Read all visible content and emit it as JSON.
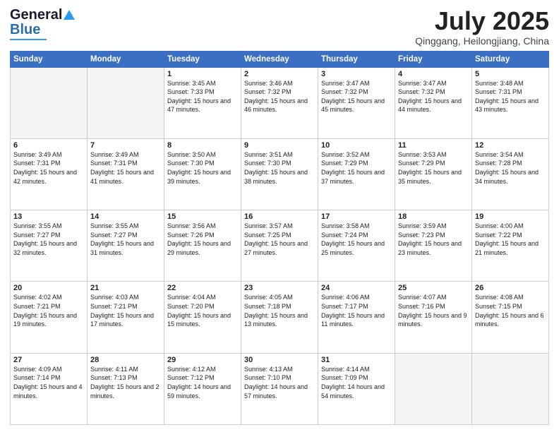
{
  "logo": {
    "line1": "General",
    "line2": "Blue"
  },
  "title": "July 2025",
  "location": "Qinggang, Heilongjiang, China",
  "weekdays": [
    "Sunday",
    "Monday",
    "Tuesday",
    "Wednesday",
    "Thursday",
    "Friday",
    "Saturday"
  ],
  "weeks": [
    [
      {
        "day": "",
        "info": ""
      },
      {
        "day": "",
        "info": ""
      },
      {
        "day": "1",
        "info": "Sunrise: 3:45 AM\nSunset: 7:33 PM\nDaylight: 15 hours\nand 47 minutes."
      },
      {
        "day": "2",
        "info": "Sunrise: 3:46 AM\nSunset: 7:32 PM\nDaylight: 15 hours\nand 46 minutes."
      },
      {
        "day": "3",
        "info": "Sunrise: 3:47 AM\nSunset: 7:32 PM\nDaylight: 15 hours\nand 45 minutes."
      },
      {
        "day": "4",
        "info": "Sunrise: 3:47 AM\nSunset: 7:32 PM\nDaylight: 15 hours\nand 44 minutes."
      },
      {
        "day": "5",
        "info": "Sunrise: 3:48 AM\nSunset: 7:31 PM\nDaylight: 15 hours\nand 43 minutes."
      }
    ],
    [
      {
        "day": "6",
        "info": "Sunrise: 3:49 AM\nSunset: 7:31 PM\nDaylight: 15 hours\nand 42 minutes."
      },
      {
        "day": "7",
        "info": "Sunrise: 3:49 AM\nSunset: 7:31 PM\nDaylight: 15 hours\nand 41 minutes."
      },
      {
        "day": "8",
        "info": "Sunrise: 3:50 AM\nSunset: 7:30 PM\nDaylight: 15 hours\nand 39 minutes."
      },
      {
        "day": "9",
        "info": "Sunrise: 3:51 AM\nSunset: 7:30 PM\nDaylight: 15 hours\nand 38 minutes."
      },
      {
        "day": "10",
        "info": "Sunrise: 3:52 AM\nSunset: 7:29 PM\nDaylight: 15 hours\nand 37 minutes."
      },
      {
        "day": "11",
        "info": "Sunrise: 3:53 AM\nSunset: 7:29 PM\nDaylight: 15 hours\nand 35 minutes."
      },
      {
        "day": "12",
        "info": "Sunrise: 3:54 AM\nSunset: 7:28 PM\nDaylight: 15 hours\nand 34 minutes."
      }
    ],
    [
      {
        "day": "13",
        "info": "Sunrise: 3:55 AM\nSunset: 7:27 PM\nDaylight: 15 hours\nand 32 minutes."
      },
      {
        "day": "14",
        "info": "Sunrise: 3:55 AM\nSunset: 7:27 PM\nDaylight: 15 hours\nand 31 minutes."
      },
      {
        "day": "15",
        "info": "Sunrise: 3:56 AM\nSunset: 7:26 PM\nDaylight: 15 hours\nand 29 minutes."
      },
      {
        "day": "16",
        "info": "Sunrise: 3:57 AM\nSunset: 7:25 PM\nDaylight: 15 hours\nand 27 minutes."
      },
      {
        "day": "17",
        "info": "Sunrise: 3:58 AM\nSunset: 7:24 PM\nDaylight: 15 hours\nand 25 minutes."
      },
      {
        "day": "18",
        "info": "Sunrise: 3:59 AM\nSunset: 7:23 PM\nDaylight: 15 hours\nand 23 minutes."
      },
      {
        "day": "19",
        "info": "Sunrise: 4:00 AM\nSunset: 7:22 PM\nDaylight: 15 hours\nand 21 minutes."
      }
    ],
    [
      {
        "day": "20",
        "info": "Sunrise: 4:02 AM\nSunset: 7:21 PM\nDaylight: 15 hours\nand 19 minutes."
      },
      {
        "day": "21",
        "info": "Sunrise: 4:03 AM\nSunset: 7:21 PM\nDaylight: 15 hours\nand 17 minutes."
      },
      {
        "day": "22",
        "info": "Sunrise: 4:04 AM\nSunset: 7:20 PM\nDaylight: 15 hours\nand 15 minutes."
      },
      {
        "day": "23",
        "info": "Sunrise: 4:05 AM\nSunset: 7:18 PM\nDaylight: 15 hours\nand 13 minutes."
      },
      {
        "day": "24",
        "info": "Sunrise: 4:06 AM\nSunset: 7:17 PM\nDaylight: 15 hours\nand 11 minutes."
      },
      {
        "day": "25",
        "info": "Sunrise: 4:07 AM\nSunset: 7:16 PM\nDaylight: 15 hours\nand 9 minutes."
      },
      {
        "day": "26",
        "info": "Sunrise: 4:08 AM\nSunset: 7:15 PM\nDaylight: 15 hours\nand 6 minutes."
      }
    ],
    [
      {
        "day": "27",
        "info": "Sunrise: 4:09 AM\nSunset: 7:14 PM\nDaylight: 15 hours\nand 4 minutes."
      },
      {
        "day": "28",
        "info": "Sunrise: 4:11 AM\nSunset: 7:13 PM\nDaylight: 15 hours\nand 2 minutes."
      },
      {
        "day": "29",
        "info": "Sunrise: 4:12 AM\nSunset: 7:12 PM\nDaylight: 14 hours\nand 59 minutes."
      },
      {
        "day": "30",
        "info": "Sunrise: 4:13 AM\nSunset: 7:10 PM\nDaylight: 14 hours\nand 57 minutes."
      },
      {
        "day": "31",
        "info": "Sunrise: 4:14 AM\nSunset: 7:09 PM\nDaylight: 14 hours\nand 54 minutes."
      },
      {
        "day": "",
        "info": ""
      },
      {
        "day": "",
        "info": ""
      }
    ]
  ]
}
